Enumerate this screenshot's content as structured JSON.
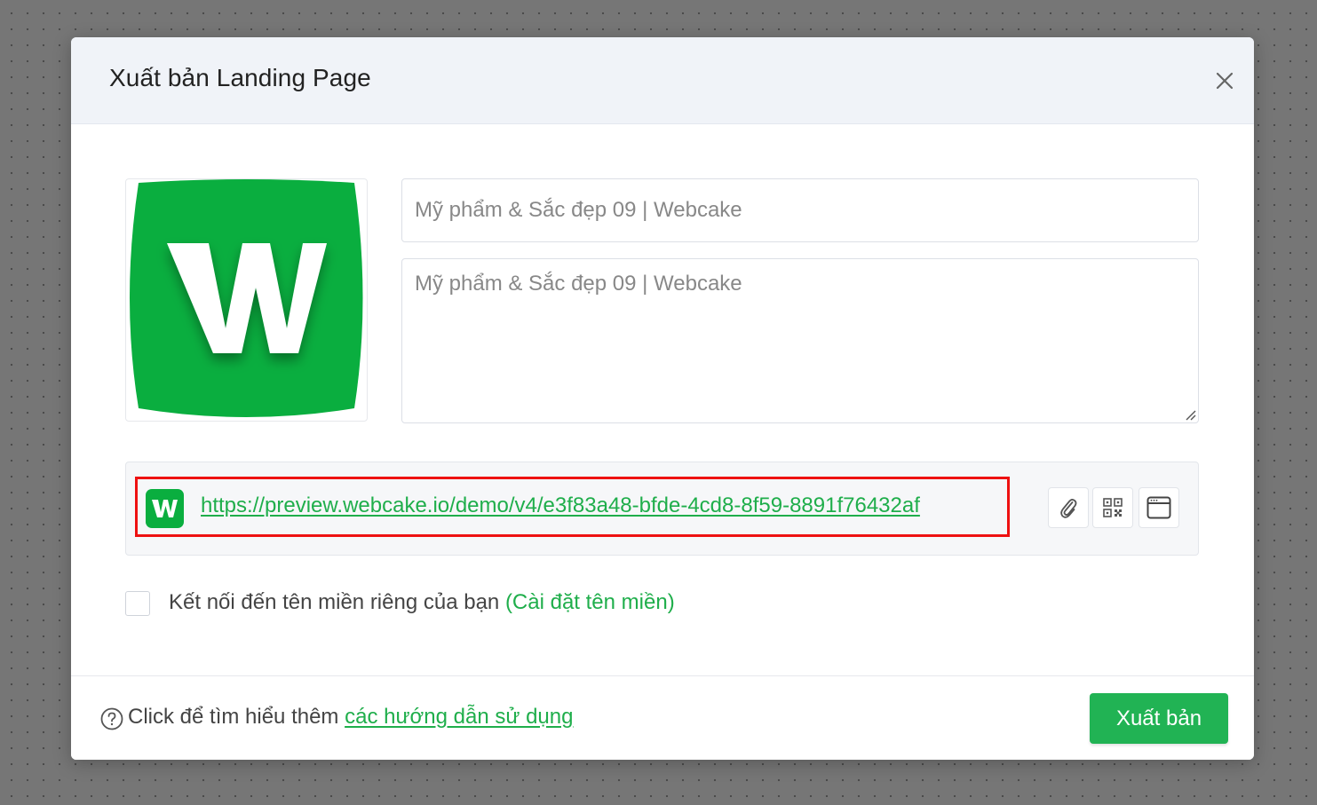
{
  "modal": {
    "title": "Xuất bản Landing Page"
  },
  "form": {
    "title_value": "Mỹ phẩm & Sắc đẹp 09 | Webcake",
    "description_value": "Mỹ phẩm & Sắc đẹp 09 | Webcake"
  },
  "thumbnail": {
    "logo_letter": "W",
    "brand_color": "#0aae3f"
  },
  "preview": {
    "url": "https://preview.webcake.io/demo/v4/e3f83a48-bfde-4cd8-8f59-8891f76432af",
    "logo_letter": "W"
  },
  "tools": [
    {
      "icon": "paperclip-icon"
    },
    {
      "icon": "qr-code-icon"
    },
    {
      "icon": "browser-window-icon"
    }
  ],
  "custom_domain": {
    "label": "Kết nối đến tên miền riêng của bạn ",
    "link_text": "(Cài đặt tên miền)",
    "checked": false
  },
  "footer": {
    "help_prefix": "Click để tìm hiểu thêm ",
    "help_link": "các hướng dẫn sử dụng",
    "publish_label": "Xuất bản"
  },
  "colors": {
    "accent": "#1fae4b",
    "highlight_border": "#ee1111",
    "header_bg": "#f0f3f8"
  }
}
